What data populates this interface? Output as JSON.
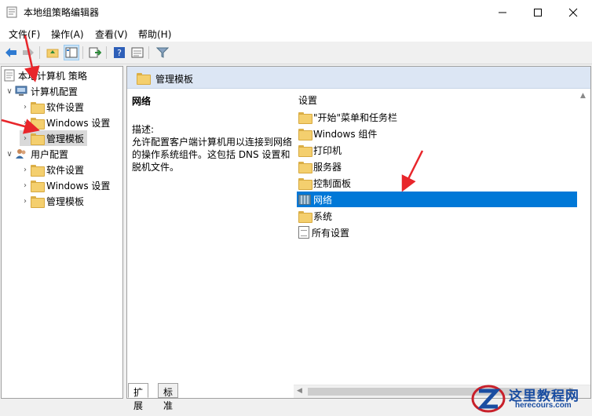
{
  "window": {
    "title": "本地组策略编辑器",
    "minimize_icon": "minimize-icon",
    "maximize_icon": "maximize-icon",
    "close_icon": "close-icon"
  },
  "menu": [
    "文件(F)",
    "操作(A)",
    "查看(V)",
    "帮助(H)"
  ],
  "tree": {
    "root": "本地计算机 策略",
    "computer_config": "计算机配置",
    "cc_software": "软件设置",
    "cc_windows": "Windows 设置",
    "cc_admin": "管理模板",
    "user_config": "用户配置",
    "uc_software": "软件设置",
    "uc_windows": "Windows 设置",
    "uc_admin": "管理模板"
  },
  "pane": {
    "header": "管理模板",
    "desc_title": "网络",
    "desc_label": "描述:",
    "desc_text": "允许配置客户端计算机用以连接到网络的操作系统组件。这包括 DNS 设置和脱机文件。",
    "column_header": "设置",
    "items": [
      "\"开始\"菜单和任务栏",
      "Windows 组件",
      "打印机",
      "服务器",
      "控制面板",
      "网络",
      "系统",
      "所有设置"
    ],
    "selected_item": "网络"
  },
  "tabs": [
    "扩展",
    "标准"
  ],
  "watermark": {
    "title": "这里教程网",
    "subtitle": "herecours.com"
  },
  "colors": {
    "selection": "#0078d7",
    "header_bg": "#dce6f4",
    "arrow": "#e8262b",
    "watermark": "#1a4da1"
  }
}
